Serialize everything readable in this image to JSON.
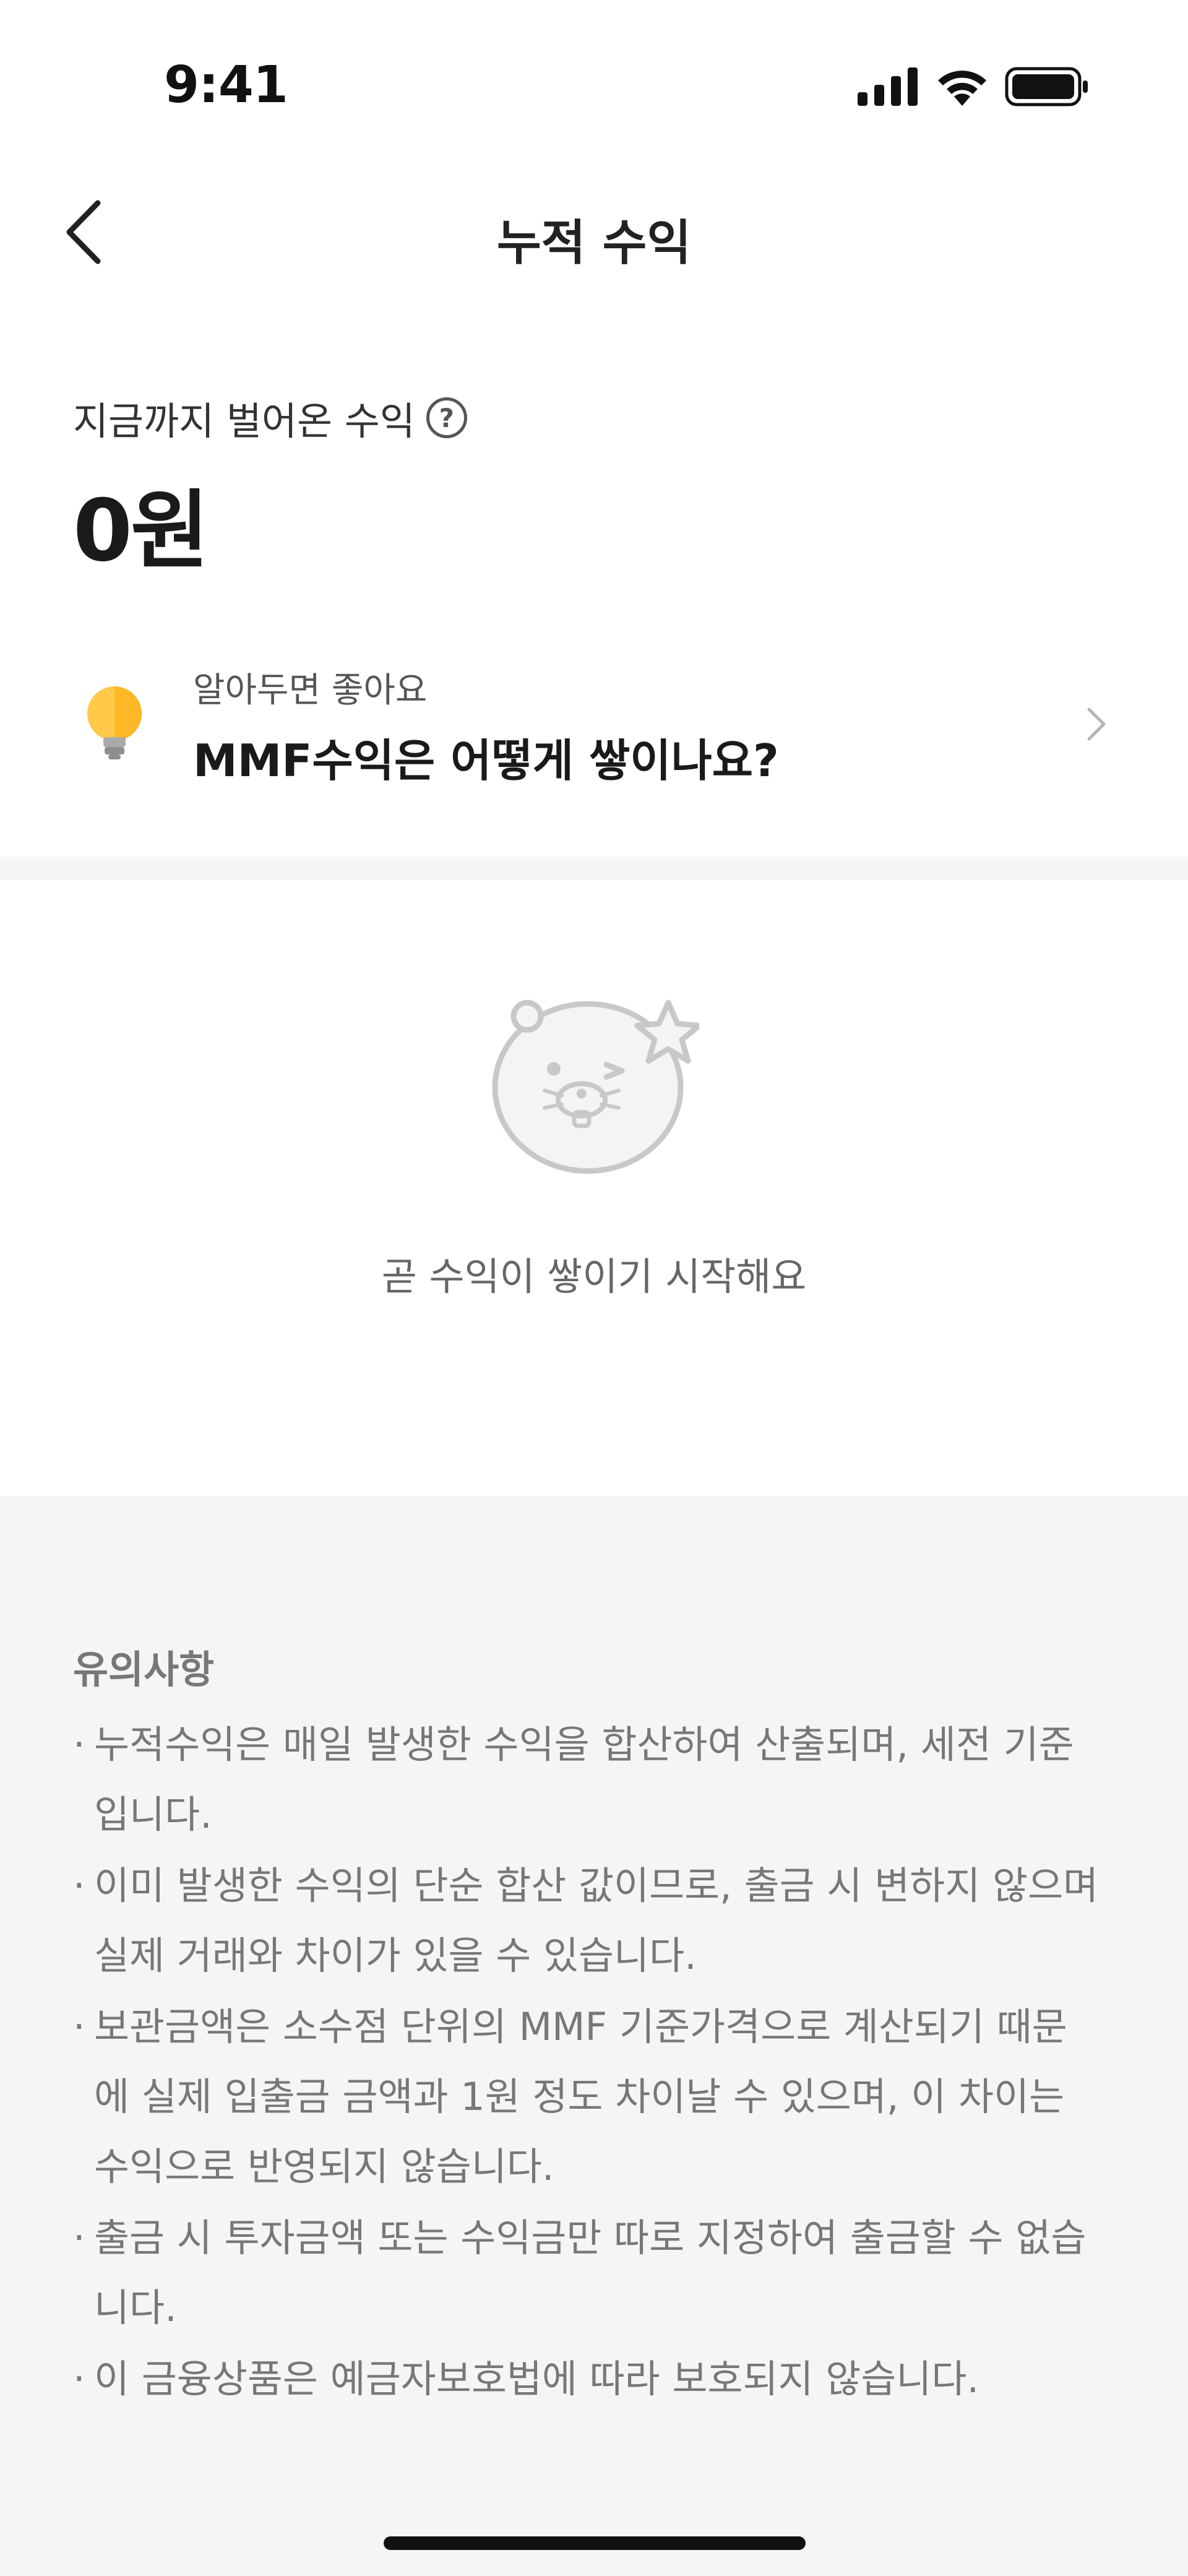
{
  "status_bar": {
    "time": "9:41",
    "icons": [
      "signal-icon",
      "wifi-icon",
      "battery-icon"
    ]
  },
  "nav": {
    "title": "누적 수익",
    "back_icon": "chevron-left-icon"
  },
  "summary": {
    "label": "지금까지 벌어온 수익",
    "help_symbol": "?",
    "amount": "0원"
  },
  "tip": {
    "subtitle": "알아두면 좋아요",
    "title": "MMF수익은 어떻게 쌓이나요?",
    "icon": "lightbulb-icon"
  },
  "empty_state": {
    "icon": "mascot-icon",
    "message": "곧 수익이 쌓이기 시작해요"
  },
  "notice": {
    "title": "유의사항",
    "items": [
      "누적수익은 매일 발생한 수익을 합산하여 산출되며, 세전 기준입니다.",
      "이미 발생한 수익의 단순 합산 값이므로, 출금 시 변하지 않으며 실제 거래와 차이가 있을 수 있습니다.",
      "보관금액은 소수점 단위의 MMF 기준가격으로 계산되기 때문에 실제 입출금 금액과 1원 정도 차이날 수 있으며, 이 차이는 수익으로 반영되지 않습니다.",
      "출금 시 투자금액 또는 수익금만 따로 지정하여 출금할 수 없습니다.",
      "이 금융상품은 예금자보호법에 따라 보호되지 않습니다."
    ]
  },
  "colors": {
    "background": "#ffffff",
    "section_gray": "#f5f5f5",
    "bulb_yellow": "#ffc94a",
    "mascot_gray": "#c8c8c8"
  }
}
